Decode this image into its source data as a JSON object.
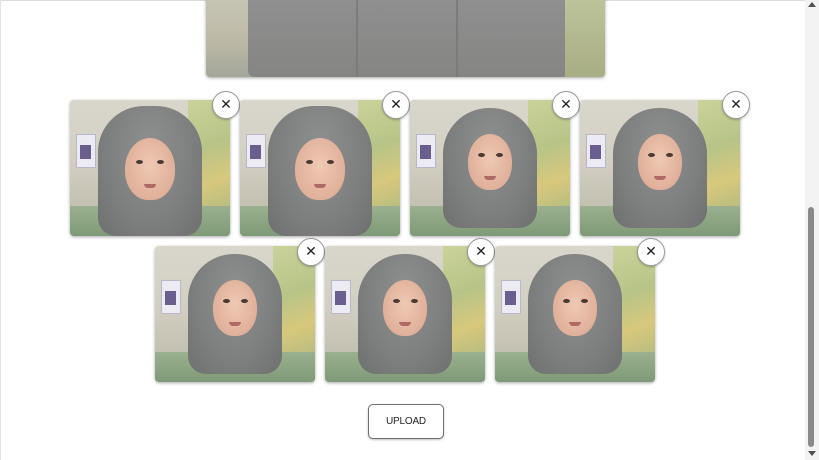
{
  "live_preview": {
    "label": "live camera preview"
  },
  "thumbnails": [
    {
      "id": "photo-1",
      "remove_icon": "close-icon"
    },
    {
      "id": "photo-2",
      "remove_icon": "close-icon"
    },
    {
      "id": "photo-3",
      "remove_icon": "close-icon"
    },
    {
      "id": "photo-4",
      "remove_icon": "close-icon"
    },
    {
      "id": "photo-5",
      "remove_icon": "close-icon"
    },
    {
      "id": "photo-6",
      "remove_icon": "close-icon"
    },
    {
      "id": "photo-7",
      "remove_icon": "close-icon"
    }
  ],
  "close_glyph": "✕",
  "upload": {
    "label": "UPLOAD"
  },
  "colors": {
    "background": "#ffffff",
    "button_border": "#6f6f6f",
    "scroll_thumb": "#8a8a8a"
  }
}
